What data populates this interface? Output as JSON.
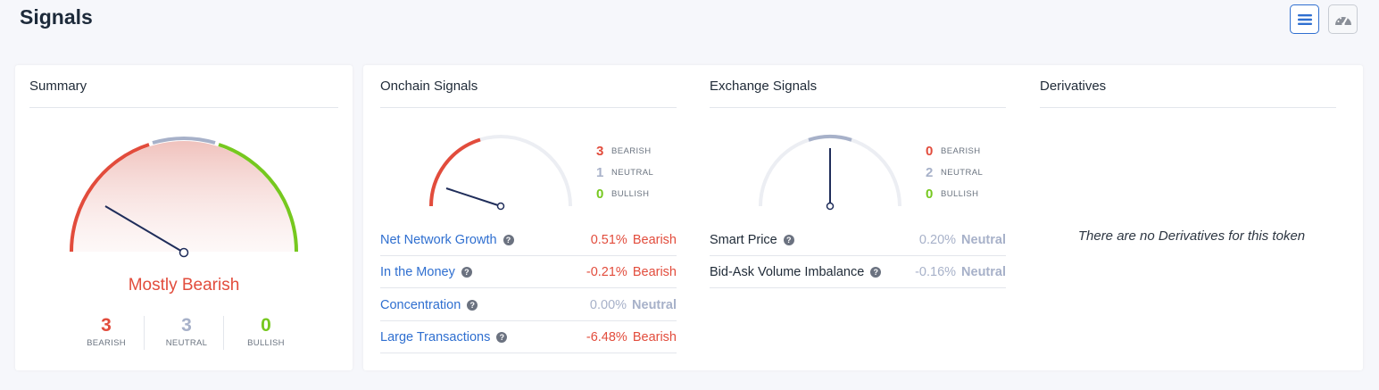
{
  "page": {
    "title": "Signals"
  },
  "toolbar": {
    "list_view_icon": "list-view-icon",
    "gauge_view_icon": "gauge-view-icon"
  },
  "summary": {
    "title": "Summary",
    "verdict": "Mostly Bearish",
    "counts": [
      {
        "value": "3",
        "label": "BEARISH",
        "color": "#e24c3c"
      },
      {
        "value": "3",
        "label": "NEUTRAL",
        "color": "#a7b1c9"
      },
      {
        "value": "0",
        "label": "BULLISH",
        "color": "#76c81f"
      }
    ]
  },
  "onchain": {
    "title": "Onchain Signals",
    "legend": [
      {
        "value": "3",
        "label": "BEARISH"
      },
      {
        "value": "1",
        "label": "NEUTRAL"
      },
      {
        "value": "0",
        "label": "BULLISH"
      }
    ],
    "rows": [
      {
        "name": "Net Network Growth",
        "pct": "0.51%",
        "status": "Bearish"
      },
      {
        "name": "In the Money",
        "pct": "-0.21%",
        "status": "Bearish"
      },
      {
        "name": "Concentration",
        "pct": "0.00%",
        "status": "Neutral"
      },
      {
        "name": "Large Transactions",
        "pct": "-6.48%",
        "status": "Bearish"
      }
    ]
  },
  "exchange": {
    "title": "Exchange Signals",
    "legend": [
      {
        "value": "0",
        "label": "BEARISH"
      },
      {
        "value": "2",
        "label": "NEUTRAL"
      },
      {
        "value": "0",
        "label": "BULLISH"
      }
    ],
    "rows": [
      {
        "name": "Smart Price",
        "pct": "0.20%",
        "status": "Neutral"
      },
      {
        "name": "Bid-Ask Volume Imbalance",
        "pct": "-0.16%",
        "status": "Neutral"
      }
    ]
  },
  "derivatives": {
    "title": "Derivatives",
    "empty_message": "There are no Derivatives for this token"
  },
  "colors": {
    "bearish": "#e24c3c",
    "neutral": "#a7b1c9",
    "bullish": "#76c81f",
    "link": "#2f6fd0"
  }
}
